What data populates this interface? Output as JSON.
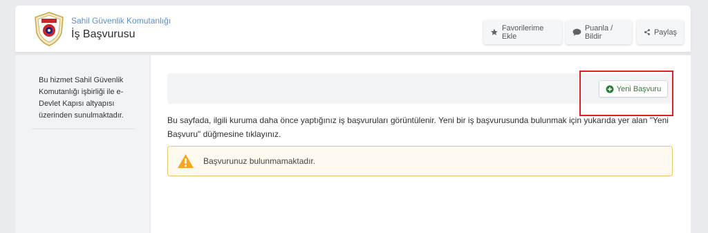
{
  "header": {
    "agency": "Sahil Güvenlik Komutanlığı",
    "title": "İş Başvurusu",
    "buttons": {
      "favorite": "Favorilerime Ekle",
      "rate": "Puanla / Bildir",
      "share": "Paylaş"
    }
  },
  "sidebar": {
    "info": "Bu hizmet Sahil Güvenlik Komutanlığı işbirliği ile e-Devlet Kapısı altyapısı üzerinden sunulmaktadır."
  },
  "main": {
    "new_application_label": "Yeni Başvuru",
    "description": "Bu sayfada, ilgili kuruma daha önce yaptığınız iş başvuruları görüntülenir. Yeni bir iş başvurusunda bulunmak için yukarıda yer alan \"Yeni Başvuru\" düğmesine tıklayınız.",
    "alert": "Başvurunuz bulunmamaktadır."
  },
  "colors": {
    "accent_blue": "#5b8fc7",
    "success_green": "#2e7d32",
    "warning": "#f5a623",
    "highlight_red": "#e02020"
  },
  "icons": {
    "favorite": "star-icon",
    "rate": "speech-bubble-icon",
    "share": "share-icon",
    "new": "plus-circle-icon",
    "alert": "warning-triangle-icon"
  }
}
